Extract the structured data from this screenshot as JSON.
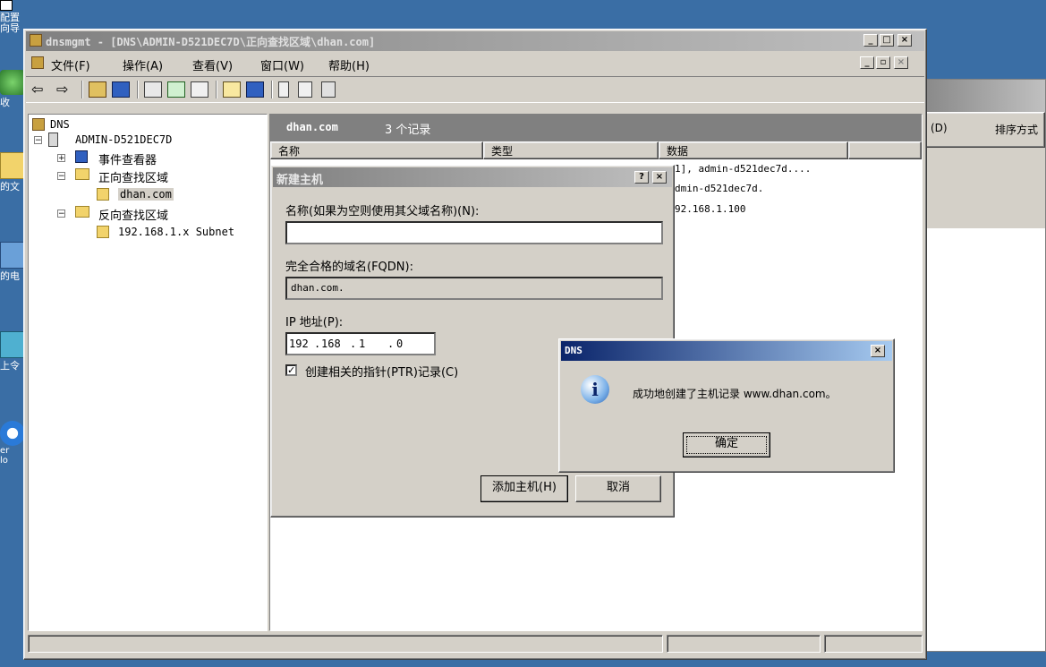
{
  "desktop": {
    "top_label": "配置向导",
    "side_labels": [
      "收",
      "的文",
      "的电",
      "上令",
      "er\nlo"
    ]
  },
  "bg_window": {
    "col1": "(D)",
    "col2": "排序方式"
  },
  "main_window": {
    "title": "dnsmgmt - [DNS\\ADMIN-D521DEC7D\\正向查找区域\\dhan.com]",
    "menu": [
      "文件(F)",
      "操作(A)",
      "查看(V)",
      "窗口(W)",
      "帮助(H)"
    ]
  },
  "tree": {
    "root": "DNS",
    "server": "ADMIN-D521DEC7D",
    "event_viewer": "事件查看器",
    "forward_zone": "正向查找区域",
    "zone_dhan": "dhan.com",
    "reverse_zone": "反向查找区域",
    "reverse_subnet": "192.168.1.x Subnet"
  },
  "right_pane": {
    "header_zone": "dhan.com",
    "header_count": "3 个记录",
    "columns": [
      "名称",
      "类型",
      "数据"
    ],
    "rows": [
      "1], admin-d521dec7d....",
      "dmin-d521dec7d.",
      "92.168.1.100"
    ]
  },
  "new_host_dialog": {
    "title": "新建主机",
    "name_label": "名称(如果为空则使用其父域名称)(N):",
    "name_value": "",
    "fqdn_label": "完全合格的域名(FQDN):",
    "fqdn_value": "dhan.com.",
    "ip_label": "IP 地址(P):",
    "ip_octets": [
      "192",
      "168",
      "1",
      "0"
    ],
    "ptr_label": "创建相关的指针(PTR)记录(C)",
    "add_button": "添加主机(H)",
    "cancel_button": "取消"
  },
  "msgbox": {
    "title": "DNS",
    "message": "成功地创建了主机记录 www.dhan.com。",
    "ok_button": "确定"
  }
}
